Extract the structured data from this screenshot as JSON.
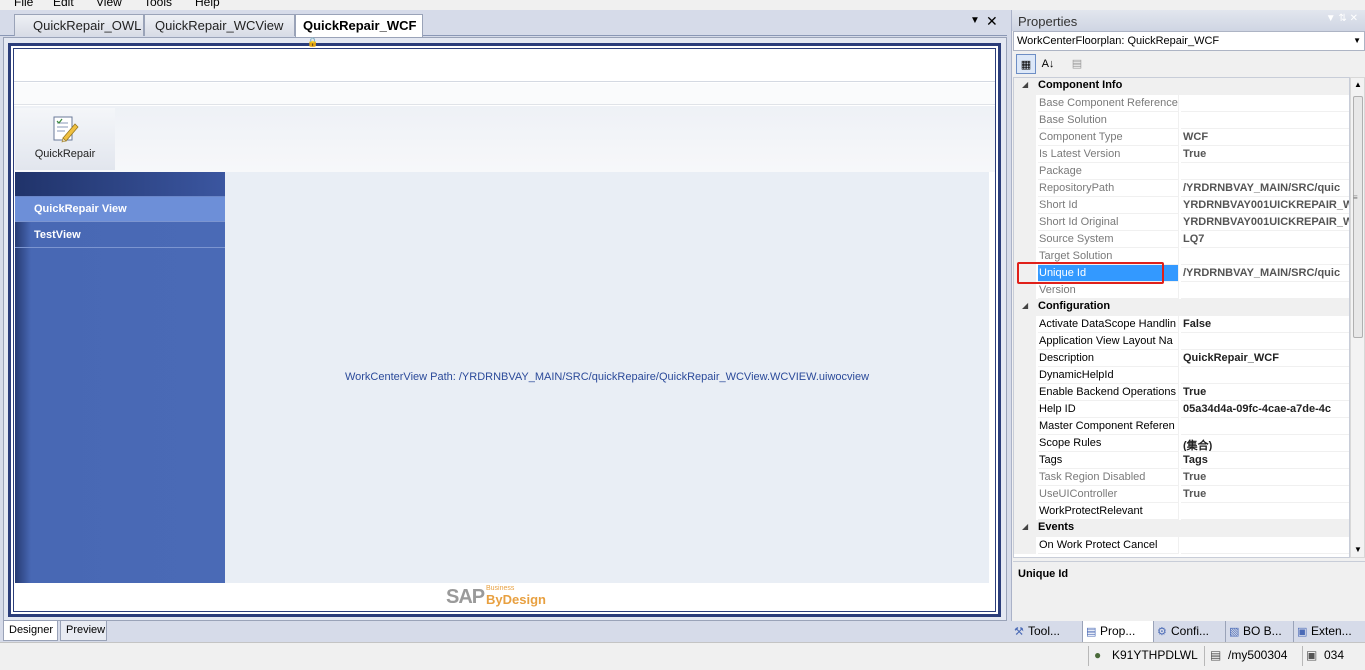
{
  "menu": [
    "File",
    "Edit",
    "View",
    "Tools",
    "Help"
  ],
  "doc_tabs": [
    {
      "label": "QuickRepair_OWL",
      "locked": false,
      "active": false
    },
    {
      "label": "QuickRepair_WCView",
      "locked": true,
      "active": false
    },
    {
      "label": "QuickRepair_WCF",
      "locked": true,
      "active": true
    }
  ],
  "icons": {
    "lock": "lock-icon",
    "dropdown": "chevron-down-icon",
    "close": "close-icon",
    "app": "notepad-pencil-icon"
  },
  "designer": {
    "app_tile_label": "QuickRepair",
    "nav_items": [
      {
        "label": "QuickRepair View",
        "selected": true
      },
      {
        "label": "TestView",
        "selected": false
      }
    ],
    "content_text": "WorkCenterView Path: /YRDRNBVAY_MAIN/SRC/quickRepaire/QuickRepair_WCView.WCVIEW.uiwocview",
    "logo_main": "SAP",
    "logo_small": "Business",
    "logo_product": "ByDesign"
  },
  "designer_tabs": [
    {
      "label": "Designer",
      "active": true
    },
    {
      "label": "Preview",
      "active": false
    }
  ],
  "properties": {
    "title": "Properties",
    "selector": "WorkCenterFloorplan: QuickRepair_WCF",
    "toolbar": [
      "categorized-icon",
      "alphabetical-icon",
      "property-pages-icon"
    ],
    "rows": [
      {
        "type": "category",
        "name": "Component Info"
      },
      {
        "type": "prop",
        "name": "Base Component Reference",
        "value": "",
        "readonly": true
      },
      {
        "type": "prop",
        "name": "Base Solution",
        "value": "",
        "readonly": true
      },
      {
        "type": "prop",
        "name": "Component Type",
        "value": "WCF",
        "readonly": true
      },
      {
        "type": "prop",
        "name": "Is Latest Version",
        "value": "True",
        "readonly": true
      },
      {
        "type": "prop",
        "name": "Package",
        "value": "",
        "readonly": true
      },
      {
        "type": "prop",
        "name": "RepositoryPath",
        "value": "/YRDRNBVAY_MAIN/SRC/quic",
        "readonly": true
      },
      {
        "type": "prop",
        "name": "Short Id",
        "value": "YRDRNBVAY001UICKREPAIR_W",
        "readonly": true
      },
      {
        "type": "prop",
        "name": "Short Id Original",
        "value": "YRDRNBVAY001UICKREPAIR_W",
        "readonly": true
      },
      {
        "type": "prop",
        "name": "Source System",
        "value": "LQ7",
        "readonly": true
      },
      {
        "type": "prop",
        "name": "Target Solution",
        "value": "",
        "readonly": true
      },
      {
        "type": "prop",
        "name": "Unique Id",
        "value": "/YRDRNBVAY_MAIN/SRC/quic",
        "readonly": true,
        "selected": true
      },
      {
        "type": "prop",
        "name": "Version",
        "value": "",
        "readonly": true
      },
      {
        "type": "category",
        "name": "Configuration"
      },
      {
        "type": "prop",
        "name": "Activate DataScope Handlin",
        "value": "False",
        "readonly": false
      },
      {
        "type": "prop",
        "name": "Application View Layout Na",
        "value": "",
        "readonly": false
      },
      {
        "type": "prop",
        "name": "Description",
        "value": "QuickRepair_WCF",
        "readonly": false
      },
      {
        "type": "prop",
        "name": "DynamicHelpId",
        "value": "",
        "readonly": false
      },
      {
        "type": "prop",
        "name": "Enable Backend Operations",
        "value": "True",
        "readonly": false
      },
      {
        "type": "prop",
        "name": "Help ID",
        "value": "05a34d4a-09fc-4cae-a7de-4c",
        "readonly": false
      },
      {
        "type": "prop",
        "name": "Master Component Referen",
        "value": "",
        "readonly": false
      },
      {
        "type": "prop",
        "name": "Scope Rules",
        "value": "(集合)",
        "readonly": false
      },
      {
        "type": "prop",
        "name": "Tags",
        "value": "Tags",
        "readonly": false
      },
      {
        "type": "prop",
        "name": "Task Region Disabled",
        "value": "True",
        "readonly": true
      },
      {
        "type": "prop",
        "name": "UseUIController",
        "value": "True",
        "readonly": true
      },
      {
        "type": "prop",
        "name": "WorkProtectRelevant",
        "value": "",
        "readonly": false
      },
      {
        "type": "category",
        "name": "Events"
      },
      {
        "type": "prop",
        "name": "On Work Protect Cancel",
        "value": "",
        "readonly": false
      }
    ],
    "description_title": "Unique Id"
  },
  "tool_tabs": [
    {
      "label": "Tool...",
      "icon": "toolbox-icon",
      "active": false
    },
    {
      "label": "Prop...",
      "icon": "properties-icon",
      "active": true
    },
    {
      "label": "Confi...",
      "icon": "configuration-icon",
      "active": false
    },
    {
      "label": "BO B...",
      "icon": "business-object-icon",
      "active": false
    },
    {
      "label": "Exten...",
      "icon": "extension-icon",
      "active": false
    }
  ],
  "status": {
    "user": "K91YTHPDLWL",
    "system": "/my500304",
    "client": "034"
  }
}
